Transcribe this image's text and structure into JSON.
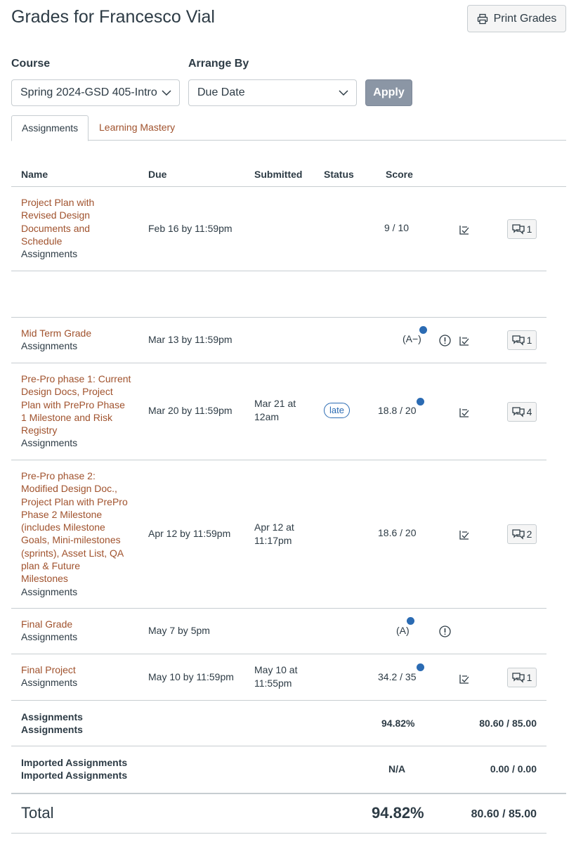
{
  "page": {
    "title": "Grades for Francesco Vial",
    "print_label": "Print Grades"
  },
  "filters": {
    "course_label": "Course",
    "course_value": "Spring 2024-GSD 405-Intro",
    "arrange_label": "Arrange By",
    "arrange_value": "Due Date",
    "apply_label": "Apply"
  },
  "tabs": [
    {
      "label": "Assignments"
    },
    {
      "label": "Learning Mastery"
    }
  ],
  "table": {
    "headers": {
      "name": "Name",
      "due": "Due",
      "submitted": "Submitted",
      "status": "Status",
      "score": "Score"
    },
    "rows": [
      {
        "name_lines": [
          "Project Plan with",
          "Revised Design",
          "Documents and",
          "Schedule"
        ],
        "group": "Assignments",
        "due": "Feb 16 by 11:59pm",
        "submitted": [],
        "status": "",
        "score": "9 / 10",
        "comments": "1"
      },
      {
        "name_lines": [
          "Mid Term Grade"
        ],
        "group": "Assignments",
        "due": "Mar 13 by 11:59pm",
        "submitted": [],
        "status": "",
        "score": "(A−)",
        "comments": "1"
      },
      {
        "name_lines": [
          "Pre-Pro phase 1: Current",
          "Design Docs, Project",
          "Plan with PrePro Phase",
          "1 Milestone and Risk",
          "Registry"
        ],
        "group": "Assignments",
        "due": "Mar 20 by 11:59pm",
        "submitted": [
          "Mar 21 at",
          "12am"
        ],
        "status": "late",
        "score": "18.8 / 20",
        "comments": "4"
      },
      {
        "name_lines": [
          "Pre-Pro phase 2:",
          "Modified Design Doc.,",
          "Project Plan with PrePro",
          "Phase 2 Milestone",
          "(includes Milestone",
          "Goals, Mini-milestones",
          "(sprints), Asset List, QA",
          "plan & Future",
          "Milestones"
        ],
        "group": "Assignments",
        "due": "Apr 12 by 11:59pm",
        "submitted": [
          "Apr 12 at",
          "11:17pm"
        ],
        "status": "",
        "score": "18.6 / 20",
        "comments": "2"
      },
      {
        "name_lines": [
          "Final Grade"
        ],
        "group": "Assignments",
        "due": "May 7 by 5pm",
        "submitted": [],
        "status": "",
        "score": "(A)",
        "comments": ""
      },
      {
        "name_lines": [
          "Final Project"
        ],
        "group": "Assignments",
        "due": "May 10 by 11:59pm",
        "submitted": [
          "May 10 at",
          "11:55pm"
        ],
        "status": "",
        "score": "34.2 / 35",
        "comments": "1"
      }
    ],
    "groups": [
      {
        "line1": "Assignments",
        "line2": "Assignments",
        "percent": "94.82%",
        "points": "80.60 / 85.00"
      },
      {
        "line1": "Imported Assignments",
        "line2": "Imported Assignments",
        "percent": "N/A",
        "points": "0.00 / 0.00"
      }
    ],
    "total": {
      "label": "Total",
      "percent": "94.82%",
      "points": "80.60 / 85.00"
    }
  },
  "colors": {
    "link": "#a0522d",
    "accent": "#2b6bb3",
    "text": "#2d3b45",
    "border": "#c7cdd1"
  },
  "icons": [
    "printer-icon",
    "chevron-down-icon",
    "rubric-icon",
    "comment-icon",
    "warning-icon",
    "unread-dot-icon"
  ]
}
